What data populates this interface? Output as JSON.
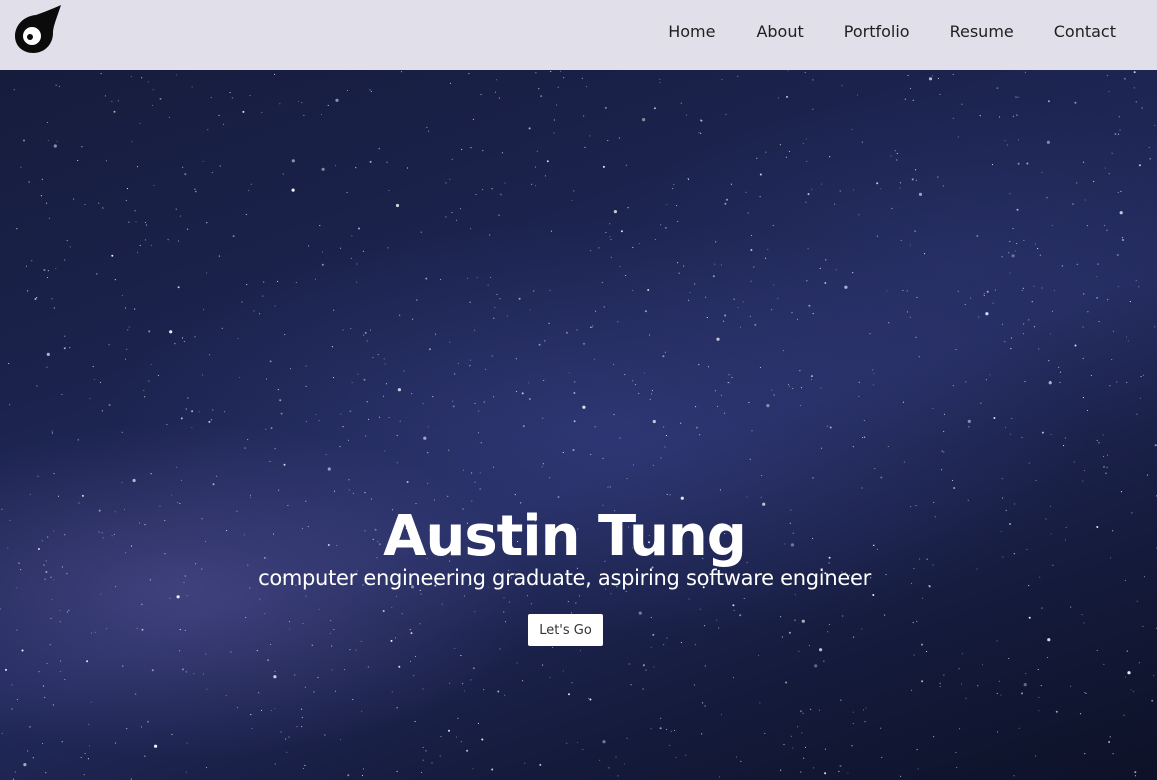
{
  "nav": {
    "items": [
      {
        "label": "Home"
      },
      {
        "label": "About"
      },
      {
        "label": "Portfolio"
      },
      {
        "label": "Resume"
      },
      {
        "label": "Contact"
      }
    ]
  },
  "hero": {
    "title": "Austin Tung",
    "subtitle": "computer engineering graduate, aspiring software engineer",
    "cta_label": "Let's Go",
    "background": "starry-night-sky"
  },
  "icons": {
    "logo": "comet-logo-icon"
  },
  "colors": {
    "navbar_bg": "#e0dfea",
    "nav_text": "#1f1f1f",
    "hero_text": "#ffffff",
    "button_bg": "#ffffff"
  }
}
